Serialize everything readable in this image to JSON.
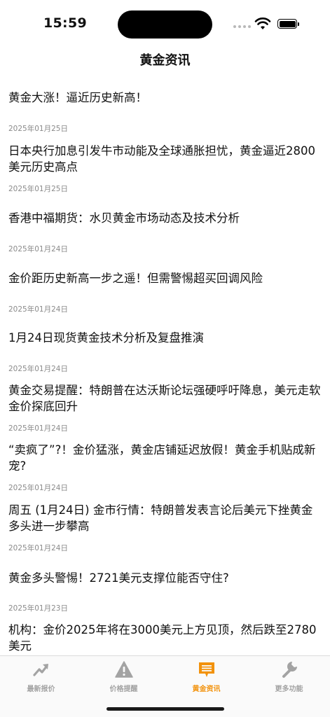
{
  "status_bar": {
    "time": "15:59"
  },
  "nav": {
    "title": "黄金资讯"
  },
  "news": [
    {
      "title": "黄金大涨！逼近历史新高！",
      "date": "2025年01月25日"
    },
    {
      "title": "日本央行加息引发牛市动能及全球通胀担忧，黄金逼近2800美元历史高点",
      "date": "2025年01月25日"
    },
    {
      "title": "香港中福期货：水贝黄金市场动态及技术分析",
      "date": "2025年01月24日"
    },
    {
      "title": "金价距历史新高一步之遥！但需警惕超买回调风险",
      "date": "2025年01月24日"
    },
    {
      "title": "1月24日现货黄金技术分析及复盘推演",
      "date": "2025年01月24日"
    },
    {
      "title": "黄金交易提醒：特朗普在达沃斯论坛强硬呼吁降息，美元走软金价探底回升",
      "date": "2025年01月24日"
    },
    {
      "title": "“卖疯了”?！金价猛涨，黄金店铺延迟放假！黄金手机贴成新宠?",
      "date": "2025年01月24日"
    },
    {
      "title": "周五 (1月24日) 金市行情：特朗普发表言论后美元下挫黄金多头进一步攀高",
      "date": "2025年01月24日"
    },
    {
      "title": "黄金多头警惕！2721美元支撑位能否守住?",
      "date": "2025年01月23日"
    },
    {
      "title": "机构：金价2025年将在3000美元上方见顶，然后跌至2780美元",
      "date": ""
    }
  ],
  "tabs": [
    {
      "label": "最新报价",
      "icon": "trend-up-icon"
    },
    {
      "label": "价格提醒",
      "icon": "warning-icon"
    },
    {
      "label": "黄金资讯",
      "icon": "news-icon",
      "active": true
    },
    {
      "label": "更多功能",
      "icon": "wrench-icon"
    }
  ],
  "colors": {
    "accent": "#f2920c",
    "inactive": "#a3a3a3"
  }
}
